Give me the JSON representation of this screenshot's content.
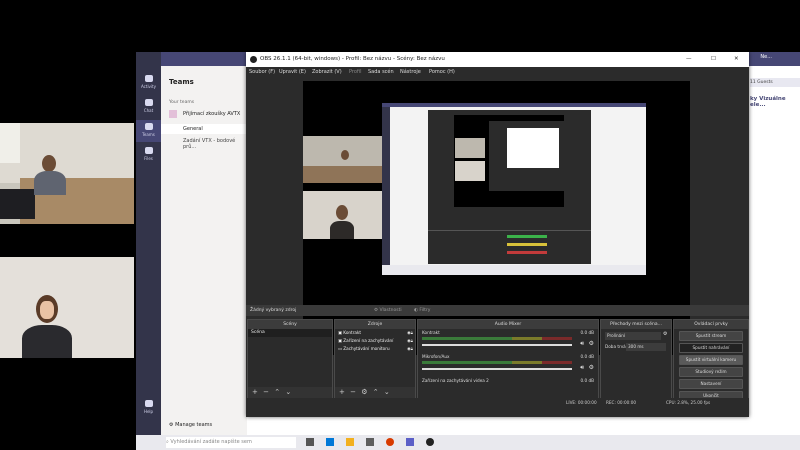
{
  "teams": {
    "header": "Teams",
    "your_teams": "Your teams",
    "team_name": "Přijímací zkoušky AVTX",
    "channel_general": "General",
    "channel_other": "Zadání VTX - bodové prů...",
    "manage": "Manage teams",
    "rail": [
      "Activity",
      "Chat",
      "Teams",
      "Files",
      "Help"
    ],
    "top_right": [
      "Ne...",
      "11 Guests"
    ],
    "right_heading": "ky Vizuálne ele..."
  },
  "taskbar": {
    "search_placeholder": "Vyhledávání zadáte napište sem"
  },
  "obs": {
    "title": "OBS 26.1.1 (64-bit, windows) - Profil: Bez názvu - Scény: Bez názvu",
    "menu": [
      "Soubor (F)",
      "Upravit (E)",
      "Zobrazit (V)",
      "Profil",
      "Sada scén",
      "Nástroje",
      "Pomoc (H)"
    ],
    "no_source": "Žádný vybraný zdroj",
    "properties": "Vlastnosti",
    "filters": "Filtry",
    "docks": {
      "scenes": {
        "title": "Scény",
        "items": [
          "Scéna"
        ]
      },
      "sources": {
        "title": "Zdroje",
        "items": [
          "Kontrakt",
          "Zařízení na zachytávání",
          "Zachytávání monitoru"
        ]
      },
      "mixer": {
        "title": "Audio Mixer",
        "channels": [
          {
            "name": "Kontrakt",
            "db": "0.0 dB"
          },
          {
            "name": "Mikrofon/Aux",
            "db": "0.0 dB"
          },
          {
            "name": "Zařízení na zachytávání videa 2",
            "db": "0.0 dB"
          }
        ]
      },
      "transitions": {
        "title": "Přechody mezi scéna...",
        "type": "Prolínání",
        "duration_label": "Doba trvání",
        "duration": "300 ms"
      },
      "controls": {
        "title": "Ovládací prvky",
        "buttons": [
          "Spustit stream",
          "Spustit nahrávání",
          "Spustit virtuální kameru",
          "Studiový režim",
          "Nastavení",
          "Ukončit"
        ]
      }
    },
    "status": {
      "live": "LIVE: 00:00:00",
      "rec": "REC: 00:00:00",
      "cpu": "CPU: 2.8%, 25.00 fps"
    }
  }
}
